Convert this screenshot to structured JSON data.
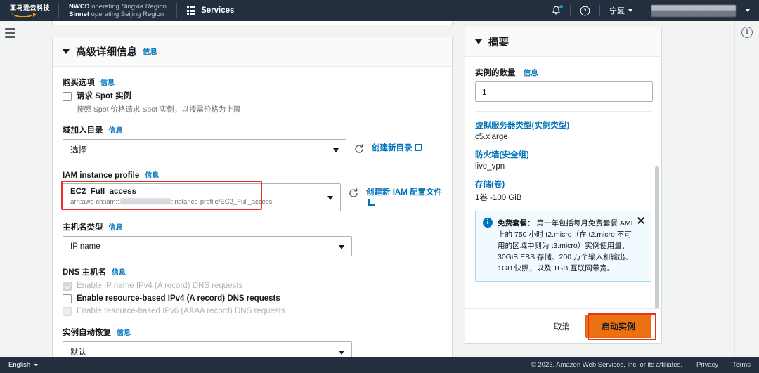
{
  "topnav": {
    "logo_text": "亚马逊云科技",
    "region_line1_bold": "NWCD",
    "region_line1_rest": " operating Ningxia Region",
    "region_line2_bold": "Sinnet",
    "region_line2_rest": " operating Beijing Region",
    "services_label": "Services",
    "notifications_icon": "bell-icon",
    "help_icon": "help-circle-icon",
    "region_selector": "宁夏",
    "account_label": ""
  },
  "leftrail": {
    "menu_icon": "hamburger-icon"
  },
  "rightrail": {
    "info_icon": "info-circle-icon",
    "info_glyph": "i"
  },
  "panel": {
    "title": "高级详细信息",
    "info_label": "信息",
    "purchase": {
      "label": "购买选项",
      "info_label": "信息",
      "spot_checkbox_label": "请求 Spot 实例",
      "spot_hint": "按照 Spot 价格请求 Spot 实例，以按需价格为上限",
      "spot_checked": false
    },
    "domain": {
      "label": "域加入目录",
      "info_label": "信息",
      "value": "选择",
      "refresh_icon": "refresh-icon",
      "create_link": "创建新目录"
    },
    "iam": {
      "label": "IAM instance profile",
      "info_label": "信息",
      "value": "EC2_Full_access",
      "arn_prefix": "arn:aws-cn:iam::",
      "arn_suffix": ":instance-profile/EC2_Full_access",
      "refresh_icon": "refresh-icon",
      "create_link": "创建新 IAM 配置文件",
      "highlighted": true
    },
    "hostname_type": {
      "label": "主机名类型",
      "info_label": "信息",
      "value": "IP name"
    },
    "dns_hostname": {
      "label": "DNS 主机名",
      "info_label": "信息",
      "options": [
        {
          "label": "Enable IP name IPv4 (A record) DNS requests",
          "checked": true,
          "disabled": true
        },
        {
          "label": "Enable resource-based IPv4 (A record) DNS requests",
          "checked": false,
          "disabled": false
        },
        {
          "label": "Enable resource-based IPv6 (AAAA record) DNS requests",
          "checked": false,
          "disabled": true
        }
      ]
    },
    "auto_recovery": {
      "label": "实例自动恢复",
      "info_label": "信息",
      "value": "默认"
    }
  },
  "summary": {
    "title": "摘要",
    "qty_label": "实例的数量",
    "qty_info": "信息",
    "qty_value": "1",
    "items": [
      {
        "link": "虚拟服务器类型(实例类型)",
        "value": "c5.xlarge"
      },
      {
        "link": "防火墙(安全组)",
        "value": "live_vpn"
      },
      {
        "link": "存储(卷)",
        "value": "1卷 -100 GiB"
      }
    ],
    "alert": {
      "icon": "info-icon",
      "title": "免费套餐：",
      "text": " 第一年包括每月免费套餐 AMI 上的 750 小时 t2.micro（在 t2.micro 不可用的区域中则为 t3.micro）实例使用量、30GiB EBS 存储、200 万个输入和输出、1GB 快照，以及 1GB 互联网带宽。",
      "close_icon": "close-icon"
    },
    "cancel_label": "取消",
    "launch_label": "启动实例",
    "launch_highlighted": true
  },
  "footer": {
    "language": "English",
    "copyright": "© 2023, Amazon Web Services, Inc. or its affiliates.",
    "privacy": "Privacy",
    "terms": "Terms"
  }
}
